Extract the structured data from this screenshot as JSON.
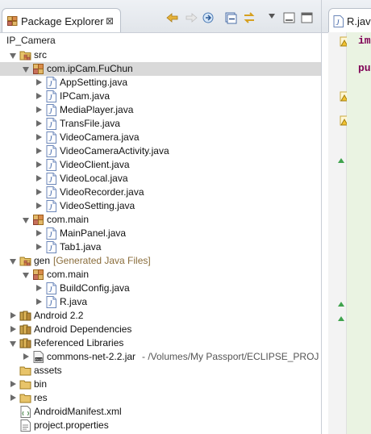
{
  "explorer": {
    "tab_title": "Package Explorer",
    "close_glyph": "⊠",
    "project": "IP_Camera",
    "tree": [
      {
        "label": "src",
        "icon": "source-folder-icon",
        "indent": 0,
        "state": "open"
      },
      {
        "label": "com.ipCam.FuChun",
        "icon": "package-icon",
        "indent": 1,
        "state": "open",
        "selected": true
      },
      {
        "label": "AppSetting.java",
        "icon": "java-file-icon",
        "indent": 2,
        "state": "closed"
      },
      {
        "label": "IPCam.java",
        "icon": "java-file-icon",
        "indent": 2,
        "state": "closed"
      },
      {
        "label": "MediaPlayer.java",
        "icon": "java-file-icon",
        "indent": 2,
        "state": "closed"
      },
      {
        "label": "TransFile.java",
        "icon": "java-file-icon",
        "indent": 2,
        "state": "closed"
      },
      {
        "label": "VideoCamera.java",
        "icon": "java-file-icon",
        "indent": 2,
        "state": "closed"
      },
      {
        "label": "VideoCameraActivity.java",
        "icon": "java-file-icon",
        "indent": 2,
        "state": "closed"
      },
      {
        "label": "VideoClient.java",
        "icon": "java-file-icon",
        "indent": 2,
        "state": "closed"
      },
      {
        "label": "VideoLocal.java",
        "icon": "java-file-icon",
        "indent": 2,
        "state": "closed"
      },
      {
        "label": "VideoRecorder.java",
        "icon": "java-file-icon",
        "indent": 2,
        "state": "closed"
      },
      {
        "label": "VideoSetting.java",
        "icon": "java-file-icon",
        "indent": 2,
        "state": "closed"
      },
      {
        "label": "com.main",
        "icon": "package-icon",
        "indent": 1,
        "state": "open"
      },
      {
        "label": "MainPanel.java",
        "icon": "java-file-icon",
        "indent": 2,
        "state": "closed"
      },
      {
        "label": "Tab1.java",
        "icon": "java-file-icon",
        "indent": 2,
        "state": "closed"
      },
      {
        "label": "gen",
        "decoration": "[Generated Java Files]",
        "icon": "source-folder-icon",
        "indent": 0,
        "state": "open"
      },
      {
        "label": "com.main",
        "icon": "package-icon",
        "indent": 1,
        "state": "open"
      },
      {
        "label": "BuildConfig.java",
        "icon": "java-file-icon",
        "indent": 2,
        "state": "closed"
      },
      {
        "label": "R.java",
        "icon": "java-file-icon",
        "indent": 2,
        "state": "closed"
      },
      {
        "label": "Android 2.2",
        "icon": "library-icon",
        "indent": 0,
        "state": "closed"
      },
      {
        "label": "Android Dependencies",
        "icon": "library-icon",
        "indent": 0,
        "state": "closed"
      },
      {
        "label": "Referenced Libraries",
        "icon": "library-icon",
        "indent": 0,
        "state": "open"
      },
      {
        "label": "commons-net-2.2.jar",
        "path": " - /Volumes/My Passport/ECLIPSE_PROJ",
        "icon": "jar-file-icon",
        "indent": 1,
        "state": "closed"
      },
      {
        "label": "assets",
        "icon": "folder-icon",
        "indent": 0,
        "state": "none"
      },
      {
        "label": "bin",
        "icon": "folder-icon",
        "indent": 0,
        "state": "closed"
      },
      {
        "label": "res",
        "icon": "folder-icon",
        "indent": 0,
        "state": "closed"
      },
      {
        "label": "AndroidManifest.xml",
        "icon": "xml-file-icon",
        "indent": 0,
        "state": "none"
      },
      {
        "label": "project.properties",
        "icon": "properties-file-icon",
        "indent": 0,
        "state": "none"
      }
    ]
  },
  "editor": {
    "tab_title": "R.jav",
    "lines": [
      "im",
      "pu"
    ]
  },
  "colors": {
    "selection": "#d9d9d9",
    "keyword": "#7f0055",
    "decoration": "#8a6d3b",
    "editor_bg": "#eaf3e2"
  }
}
